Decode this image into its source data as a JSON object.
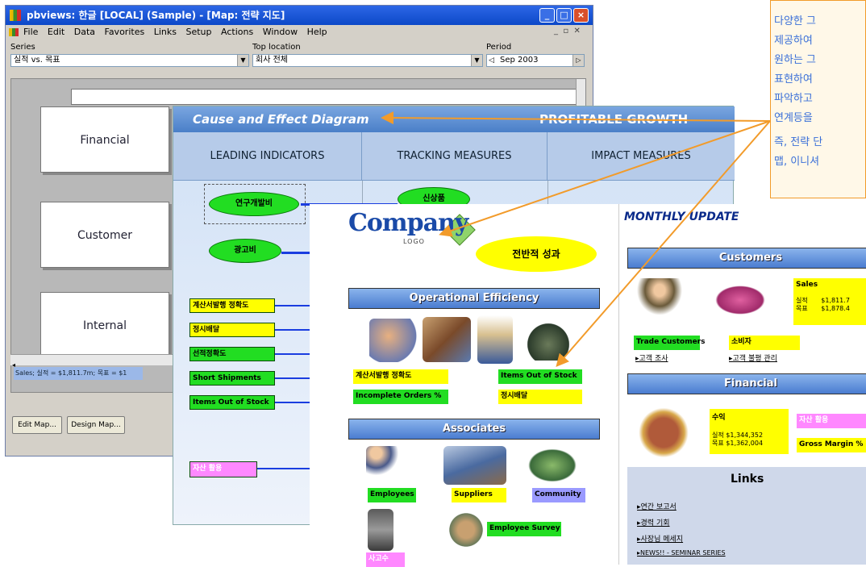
{
  "window": {
    "title": "pbviews: 한글 [LOCAL] (Sample) - [Map: 전략 지도]",
    "menu": [
      "File",
      "Edit",
      "Data",
      "Favorites",
      "Links",
      "Setup",
      "Actions",
      "Window",
      "Help"
    ],
    "series_label": "Series",
    "series_value": "실적 vs. 목표",
    "location_label": "Top location",
    "location_value": "회사 전체",
    "period_label": "Period",
    "period_value": "Sep 2003",
    "boxes": [
      "Financial",
      "Customer",
      "Internal"
    ],
    "status_line": "Sales; 실적 = $1,811.7m; 목표 = $1",
    "edit_map": "Edit Map...",
    "design_map": "Design Map...",
    "colors": {
      "title_bar": "#0c48c8"
    }
  },
  "cause_effect": {
    "title": "Cause and Effect Diagram",
    "right_title": "PROFITABLE GROWTH",
    "columns": [
      "LEADING INDICATORS",
      "TRACKING MEASURES",
      "IMPACT MEASURES"
    ],
    "ovals": [
      "연구개발비",
      "광고비",
      "신상품"
    ],
    "tags": [
      "계산서발행 정확도",
      "정시배달",
      "선적정확도",
      "Short Shipments",
      "Items Out of Stock",
      "자산 활용"
    ]
  },
  "company": {
    "logo": "Company",
    "logo_sub": "LOGO",
    "overall": "전반적 성과",
    "monthly": "MONTHLY UPDATE",
    "operational": "Operational Efficiency",
    "op_tags": [
      "계산서발행 정확도",
      "Items Out of Stock",
      "Incomplete Orders %",
      "정시배달"
    ],
    "associates": "Associates",
    "assoc_tags": [
      "Employees",
      "Suppliers",
      "Community",
      "Employee Survey",
      "사고수"
    ],
    "customers": "Customers",
    "sales_title": "Sales",
    "sales_rows": [
      "실적",
      "목표"
    ],
    "sales_vals": [
      "$1,811.7",
      "$1,878.4"
    ],
    "cust_tags": [
      "Trade Customers",
      "소비자"
    ],
    "cust_links": [
      "고객 조사",
      "고객 불평 관리"
    ],
    "financial": "Financial",
    "rev_title": "수익",
    "rev_rows": [
      "실적  $1,344,352",
      "목표  $1,362,004"
    ],
    "asset": "자산 활용",
    "gross": "Gross Margin %",
    "links_title": "Links",
    "links": [
      "연간 보고서",
      "경력 기회",
      "사장님 메세지",
      "NEWS!! - SEMINAR SERIES"
    ]
  },
  "callout": {
    "lines": [
      "다양한 그",
      "제공하여",
      "원하는 그",
      "표현하여",
      "파악하고",
      "연계등을"
    ],
    "lines2": [
      "즉, 전략 단",
      "맵, 이니셔"
    ]
  }
}
